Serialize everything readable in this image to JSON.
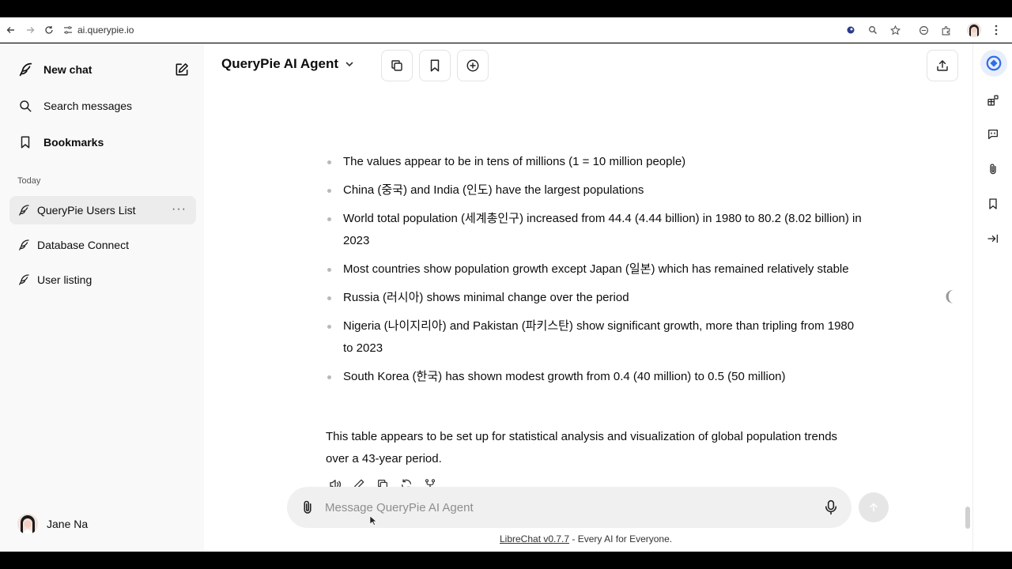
{
  "browser": {
    "url": "ai.querypie.io"
  },
  "sidebar": {
    "new_chat": "New chat",
    "search": "Search messages",
    "bookmarks": "Bookmarks",
    "section_today": "Today",
    "conversations": [
      {
        "label": "QueryPie Users List",
        "active": true
      },
      {
        "label": "Database Connect",
        "active": false
      },
      {
        "label": "User listing",
        "active": false
      }
    ],
    "more_glyph": "···",
    "user_name": "Jane Na"
  },
  "header": {
    "title": "QueryPie AI Agent"
  },
  "message": {
    "bullets": [
      "The values appear to be in tens of millions (1 = 10 million people)",
      "China (중국) and India (인도) have the largest populations",
      "World total population (세계총인구) increased from 44.4 (4.44 billion) in 1980 to 80.2 (8.02 billion) in 2023",
      "Most countries show population growth except Japan (일본) which has remained relatively stable",
      "Russia (러시아) shows minimal change over the period",
      "Nigeria (나이지리아) and Pakistan (파키스탄) show significant growth, more than tripling from 1980 to 2023",
      "South Korea (한국) has shown modest growth from 0.4 (40 million) to 0.5 (50 million)"
    ],
    "summary": "This table appears to be set up for statistical analysis and visualization of global population trends over a 43-year period."
  },
  "composer": {
    "placeholder": "Message QueryPie AI Agent"
  },
  "footer": {
    "link": "LibreChat v0.7.7",
    "text": " - Every AI for Everyone."
  },
  "colors": {
    "accent": "#2f6fe4",
    "sidebar_bg": "#f9f9f9",
    "active_item": "#ececec"
  }
}
